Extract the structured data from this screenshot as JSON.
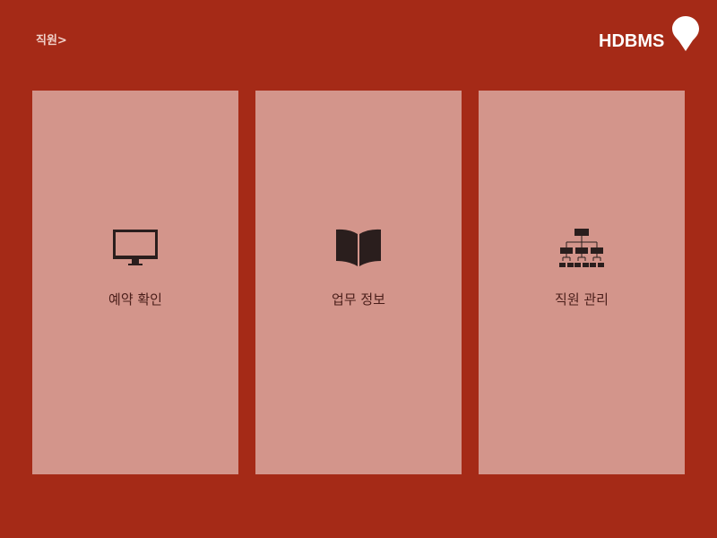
{
  "header": {
    "breadcrumb": "직원>",
    "logo": "HDBMS",
    "logo_icon": "map-pin-icon"
  },
  "colors": {
    "background": "#a52a17",
    "card": "#d3958b"
  },
  "cards": [
    {
      "label": "예약 확인",
      "icon": "monitor-icon"
    },
    {
      "label": "업무 정보",
      "icon": "book-icon"
    },
    {
      "label": "직원 관리",
      "icon": "org-chart-icon"
    }
  ]
}
